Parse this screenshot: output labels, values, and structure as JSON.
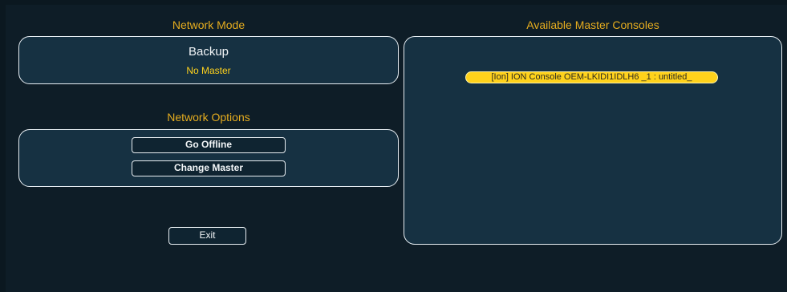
{
  "network_mode": {
    "title": "Network Mode",
    "mode": "Backup",
    "status": "No Master"
  },
  "network_options": {
    "title": "Network Options",
    "go_offline_label": "Go Offline",
    "change_master_label": "Change Master"
  },
  "exit_label": "Exit",
  "available_consoles": {
    "title": "Available Master Consoles",
    "items": [
      {
        "label": "[Ion] ION Console OEM-LKIDI1IDLH6 _1 : untitled_"
      }
    ]
  },
  "colors": {
    "accent_gold": "#e6ad1f",
    "status_yellow": "#ffd21c",
    "panel_fill": "#163142",
    "background": "#0e1d27"
  }
}
